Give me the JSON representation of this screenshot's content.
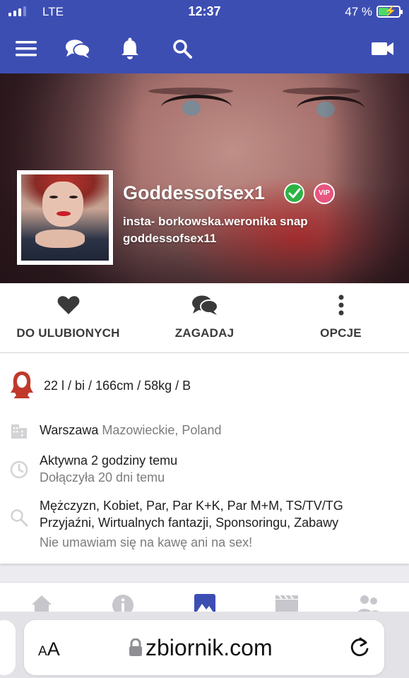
{
  "status_bar": {
    "carrier": "LTE",
    "time": "12:37",
    "battery": "47 %"
  },
  "profile": {
    "name": "Goddessofsex1",
    "vip_badge": "VIP",
    "bio_line1": "insta- borkowska.weronika snap",
    "bio_line2": "goddessofsex11"
  },
  "actions": [
    {
      "label": "DO ULUBIONYCH",
      "icon": "heart-icon"
    },
    {
      "label": "ZAGADAJ",
      "icon": "chat-icon"
    },
    {
      "label": "OPCJE",
      "icon": "more-vertical-icon"
    }
  ],
  "details": {
    "stats": "22 l / bi / 166cm / 58kg / B",
    "city": "Warszawa",
    "region": "Mazowieckie, Poland",
    "active": "Aktywna 2 godziny temu",
    "joined": "Dołączyła 20 dni temu",
    "looking_for_line1": "Mężczyzn, Kobiet, Par, Par K+K, Par M+M, TS/TV/TG",
    "looking_for_line2": "Przyjaźni, Wirtualnych fantazji, Sponsoringu, Zabawy",
    "note": "Nie umawiam się na kawę ani na sex!"
  },
  "tabs": [
    {
      "icon": "home-icon",
      "active": false
    },
    {
      "icon": "info-icon",
      "active": false
    },
    {
      "icon": "photos-icon",
      "active": true
    },
    {
      "icon": "video-icon",
      "active": false
    },
    {
      "icon": "friends-icon",
      "active": false
    }
  ],
  "browser": {
    "text_size_label_small": "A",
    "text_size_label_large": "A",
    "url": "zbiornik.com"
  },
  "colors": {
    "brand": "#3d4eb3",
    "verified": "#2fb344",
    "vip": "#e8557f",
    "accent_red": "#c0392b"
  }
}
